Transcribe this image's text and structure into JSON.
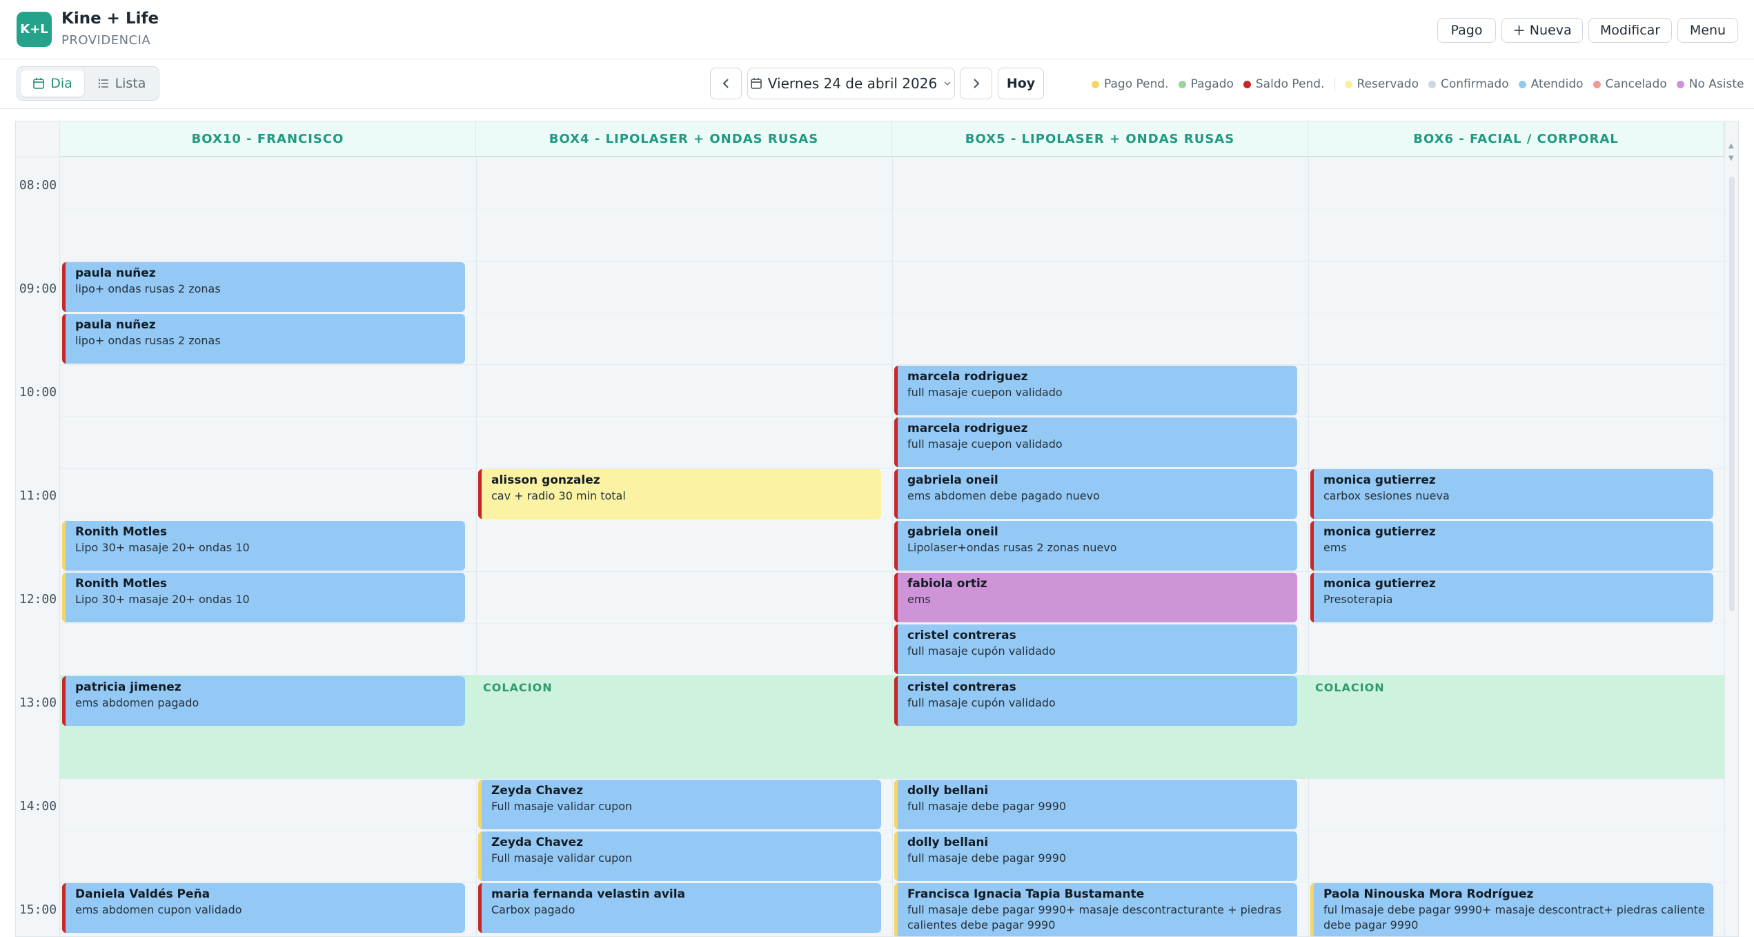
{
  "header": {
    "logo_text": "K+L",
    "brand": "Kine + Life",
    "branch": "PROVIDENCIA",
    "buttons": {
      "pago": "Pago",
      "nueva": "Nueva",
      "modificar": "Modificar",
      "menu": "Menu"
    }
  },
  "toolbar": {
    "view_dia": "Dia",
    "view_lista": "Lista",
    "date": "Viernes 24 de abril 2026",
    "hoy": "Hoy",
    "legend_payment": [
      {
        "label": "Pago Pend.",
        "color": "#f5d565"
      },
      {
        "label": "Pagado",
        "color": "#9ed49a"
      },
      {
        "label": "Saldo Pend.",
        "color": "#c62828"
      }
    ],
    "legend_status": [
      {
        "label": "Reservado",
        "color": "#fbf09a"
      },
      {
        "label": "Confirmado",
        "color": "#d0d5d9"
      },
      {
        "label": "Atendido",
        "color": "#95c9f5"
      },
      {
        "label": "Cancelado",
        "color": "#ef9a9a"
      },
      {
        "label": "No Asiste",
        "color": "#cf93d8"
      }
    ]
  },
  "calendar": {
    "columns": [
      "BOX10 - FRANCISCO",
      "BOX4 - LIPOLASER + ONDAS RUSAS",
      "BOX5 - LIPOLASER + ONDAS RUSAS",
      "BOX6 - FACIAL / CORPORAL"
    ],
    "hours": [
      "08:00",
      "09:00",
      "10:00",
      "11:00",
      "12:00",
      "13:00",
      "14:00",
      "15:00"
    ],
    "colacion_label": "COLACION",
    "appointments": {
      "box10": [
        {
          "name": "paula nuñez",
          "desc": "lipo+ ondas rusas 2 zonas"
        },
        {
          "name": "paula nuñez",
          "desc": "lipo+ ondas rusas 2 zonas"
        },
        {
          "name": "Ronith Motles",
          "desc": "Lipo 30+ masaje 20+ ondas 10"
        },
        {
          "name": "Ronith Motles",
          "desc": "Lipo 30+ masaje 20+ ondas 10"
        },
        {
          "name": "patricia jimenez",
          "desc": "ems abdomen pagado"
        },
        {
          "name": "Daniela Valdés Peña",
          "desc": "ems abdomen cupon validado"
        }
      ],
      "box4": [
        {
          "name": "alisson gonzalez",
          "desc": "cav + radio 30 min total"
        },
        {
          "name": "Zeyda Chavez",
          "desc": "Full masaje validar cupon"
        },
        {
          "name": "Zeyda Chavez",
          "desc": "Full masaje validar cupon"
        },
        {
          "name": "maria fernanda velastin avila",
          "desc": "Carbox pagado"
        }
      ],
      "box5": [
        {
          "name": "marcela rodriguez",
          "desc": "full masaje cuepon validado"
        },
        {
          "name": "marcela rodriguez",
          "desc": "full masaje cuepon validado"
        },
        {
          "name": "gabriela oneil",
          "desc": "ems abdomen debe pagado nuevo"
        },
        {
          "name": "gabriela oneil",
          "desc": "Lipolaser+ondas rusas 2 zonas nuevo"
        },
        {
          "name": "fabiola ortiz",
          "desc": "ems"
        },
        {
          "name": "cristel contreras",
          "desc": "full masaje cupón validado"
        },
        {
          "name": "cristel contreras",
          "desc": "full masaje cupón validado"
        },
        {
          "name": "dolly bellani",
          "desc": "full masaje debe pagar 9990"
        },
        {
          "name": "dolly bellani",
          "desc": "full masaje debe pagar 9990"
        },
        {
          "name": "Francisca Ignacia Tapia Bustamante",
          "desc": "full masaje debe pagar 9990+ masaje descontracturante + piedras calientes debe pagar 9990"
        }
      ],
      "box6": [
        {
          "name": "monica gutierrez",
          "desc": "carbox sesiones nueva"
        },
        {
          "name": "monica gutierrez",
          "desc": "ems"
        },
        {
          "name": "monica gutierrez",
          "desc": "Presoterapia"
        },
        {
          "name": "Paola Ninouska Mora Rodríguez",
          "desc": "ful lmasaje debe pagar 9990+ masaje descontract+ piedras caliente debe pagar 9990"
        }
      ]
    }
  }
}
